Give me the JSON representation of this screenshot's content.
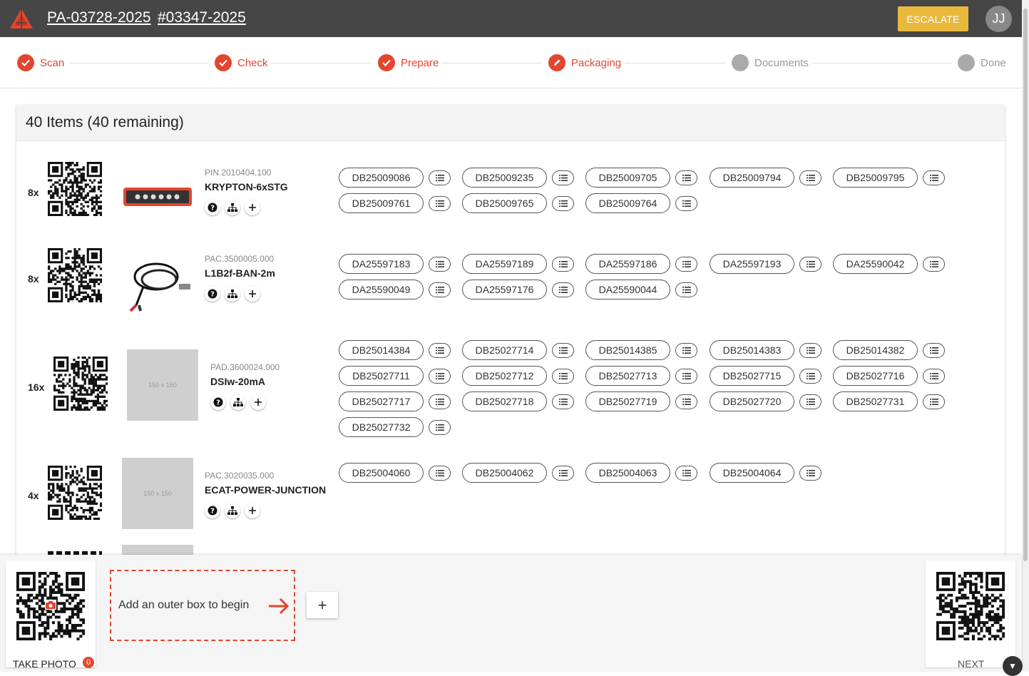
{
  "header": {
    "order_ref": "PA-03728-2025",
    "ticket_ref": "#03347-2025",
    "escalate_label": "ESCALATE",
    "avatar_initials": "JJ"
  },
  "steps": [
    {
      "label": "Scan",
      "state": "done"
    },
    {
      "label": "Check",
      "state": "done"
    },
    {
      "label": "Prepare",
      "state": "done"
    },
    {
      "label": "Packaging",
      "state": "current"
    },
    {
      "label": "Documents",
      "state": "pending"
    },
    {
      "label": "Done",
      "state": "pending"
    }
  ],
  "items_title": "40 Items (40 remaining)",
  "items": [
    {
      "qty": "8x",
      "part_number": "PIN.2010404.100",
      "name": "KRYPTON-6xSTG",
      "image": "device",
      "serials": [
        "DB25009086",
        "DB25009235",
        "DB25009705",
        "DB25009794",
        "DB25009795",
        "DB25009761",
        "DB25009765",
        "DB25009764"
      ]
    },
    {
      "qty": "8x",
      "part_number": "PAC.3500005.000",
      "name": "L1B2f-BAN-2m",
      "image": "cable",
      "serials": [
        "DA25597183",
        "DA25597189",
        "DA25597186",
        "DA25597193",
        "DA25590042",
        "DA25590049",
        "DA25597176",
        "DA25590044"
      ]
    },
    {
      "qty": "16x",
      "part_number": "PAD.3600024.000",
      "name": "DSIw-20mA",
      "image": "150 x 150",
      "serials": [
        "DB25014384",
        "DB25027714",
        "DB25014385",
        "DB25014383",
        "DB25014382",
        "DB25027711",
        "DB25027712",
        "DB25027713",
        "DB25027715",
        "DB25027716",
        "DB25027717",
        "DB25027718",
        "DB25027719",
        "DB25027720",
        "DB25027731",
        "DB25027732"
      ]
    },
    {
      "qty": "4x",
      "part_number": "PAC.3020035.000",
      "name": "ECAT-POWER-JUNCTION",
      "image": "150 x 150",
      "serials": [
        "DB25004060",
        "DB25004062",
        "DB25004063",
        "DB25004064"
      ]
    }
  ],
  "bottom": {
    "take_photo_label": "TAKE PHOTO",
    "photo_count": "0",
    "dropzone_text": "Add an outer box to begin",
    "add_label": "+",
    "next_label": "NEXT"
  },
  "colors": {
    "accent": "#e4452e",
    "escalate": "#e9b93c",
    "topbar": "#464646"
  },
  "icons": [
    "logo-icon",
    "check-icon",
    "pencil-icon",
    "help-icon",
    "hierarchy-icon",
    "plus-icon",
    "list-icon",
    "camera-icon",
    "arrow-right-icon",
    "chevron-down-icon"
  ]
}
